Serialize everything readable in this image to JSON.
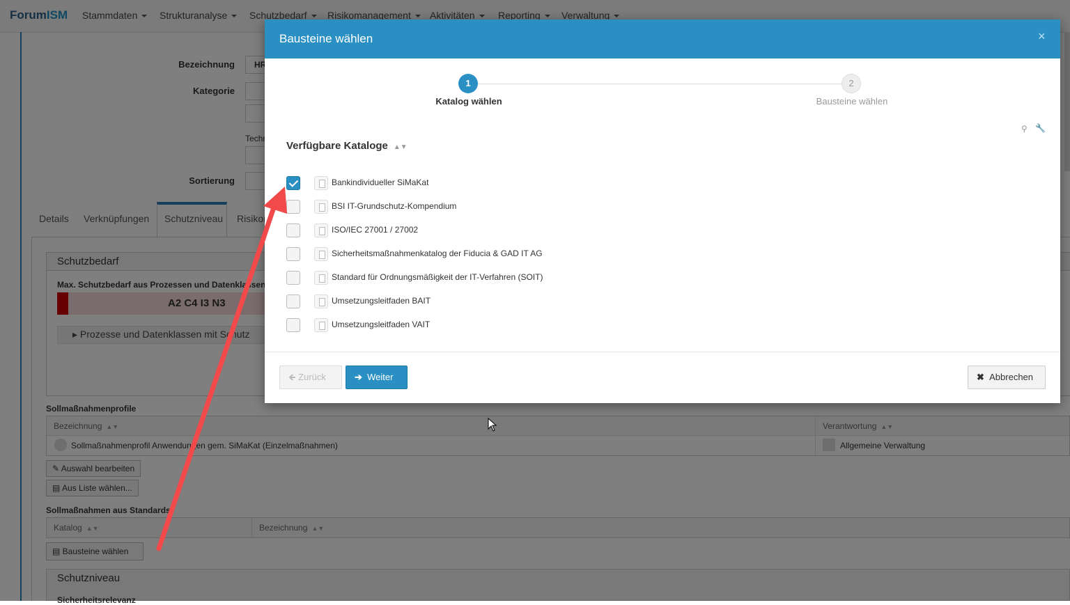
{
  "navbar": {
    "brand_prefix": "Forum",
    "brand_suffix": "ISM",
    "menu": [
      "Stammdaten",
      "Strukturanalyse",
      "Schutzbedarf",
      "Risikomanagement",
      "Aktivitäten",
      "Reporting",
      "Verwaltung"
    ]
  },
  "background": {
    "form": {
      "bezeichnung_label": "Bezeichnung",
      "bezeichnung_value": "HR",
      "kategorie_label": "Kategorie",
      "techn_label": "Techn",
      "sortierung_label": "Sortierung"
    },
    "tabs": [
      "Details",
      "Verknüpfungen",
      "Schutzniveau",
      "Risikon"
    ],
    "schutzbedarf": {
      "title": "Schutzbedarf",
      "max_label": "Max. Schutzbedarf aus Prozessen und Datenklassen",
      "value": "A2 C4 I3 N3",
      "collapser": "Prozesse und Datenklassen mit Schutz"
    },
    "soll_profile": {
      "title": "Sollmaßnahmenprofile",
      "col_bezeichnung": "Bezeichnung",
      "col_verantwortung": "Verantwortung",
      "row_bezeichnung": "Sollmaßnahmenprofil Anwendungen gem. SiMaKat (Einzelmaßnahmen)",
      "row_verantwortung": "Allgemeine Verwaltung",
      "btn_edit": "Auswahl bearbeiten",
      "btn_list": "Aus Liste wählen..."
    },
    "soll_standards": {
      "title": "Sollmaßnahmen aus Standards",
      "col_katalog": "Katalog",
      "col_bezeichnung": "Bezeichnung",
      "btn_bausteine": "Bausteine wählen"
    },
    "schutzniveau": {
      "title": "Schutzniveau",
      "sub": "Sicherheitsrelevanz"
    }
  },
  "modal": {
    "title": "Bausteine wählen",
    "close": "×",
    "steps": [
      {
        "number": "1",
        "label": "Katalog wählen",
        "active": true
      },
      {
        "number": "2",
        "label": "Bausteine wählen",
        "active": false
      }
    ],
    "catalog_title": "Verfügbare Kataloge",
    "catalogs": [
      {
        "label": "Bankindividueller SiMaKat",
        "checked": true
      },
      {
        "label": "BSI IT-Grundschutz-Kompendium",
        "checked": false
      },
      {
        "label": "ISO/IEC 27001 / 27002",
        "checked": false
      },
      {
        "label": "Sicherheitsmaßnahmenkatalog der Fiducia & GAD IT AG",
        "checked": false
      },
      {
        "label": "Standard für Ordnungsmäßigkeit der IT-Verfahren (SOIT)",
        "checked": false
      },
      {
        "label": "Umsetzungsleitfaden BAIT",
        "checked": false
      },
      {
        "label": "Umsetzungsleitfaden VAIT",
        "checked": false
      }
    ],
    "buttons": {
      "back": "Zurück",
      "next": "Weiter",
      "cancel": "Abbrechen"
    }
  },
  "colors": {
    "accent": "#2a90c3",
    "arrow": "#f24a4a"
  }
}
